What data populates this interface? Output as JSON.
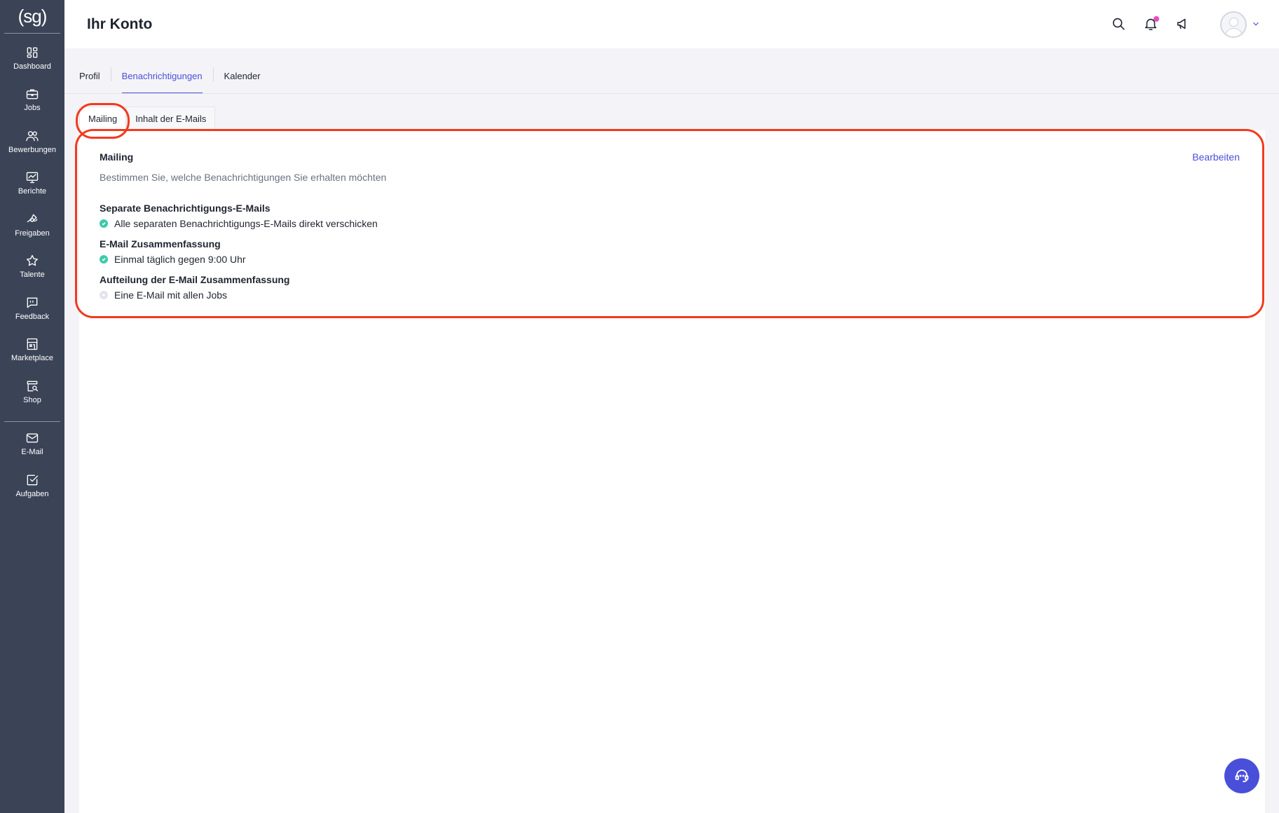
{
  "app": {
    "logo_text": "(sg)"
  },
  "sidebar": {
    "items": [
      {
        "label": "Dashboard",
        "icon": "dashboard-icon"
      },
      {
        "label": "Jobs",
        "icon": "briefcase-icon"
      },
      {
        "label": "Bewerbungen",
        "icon": "users-icon"
      },
      {
        "label": "Berichte",
        "icon": "chart-icon"
      },
      {
        "label": "Freigaben",
        "icon": "hand-sign-icon"
      },
      {
        "label": "Talente",
        "icon": "star-icon"
      },
      {
        "label": "Feedback",
        "icon": "chat-quote-icon"
      },
      {
        "label": "Marketplace",
        "icon": "store-icon"
      },
      {
        "label": "Shop",
        "icon": "shop-search-icon"
      },
      {
        "label": "E-Mail",
        "icon": "mail-icon"
      },
      {
        "label": "Aufgaben",
        "icon": "checkbox-icon"
      }
    ]
  },
  "header": {
    "title": "Ihr Konto"
  },
  "tabs": [
    {
      "label": "Profil",
      "active": false
    },
    {
      "label": "Benachrichtigungen",
      "active": true
    },
    {
      "label": "Kalender",
      "active": false
    }
  ],
  "subtabs": [
    {
      "label": "Mailing",
      "active": true
    },
    {
      "label": "Inhalt der E-Mails",
      "active": false
    }
  ],
  "card": {
    "title": "Mailing",
    "edit_label": "Bearbeiten",
    "description": "Bestimmen Sie, welche Benachrichtigungen Sie erhalten möchten",
    "sections": [
      {
        "title": "Separate Benachrichtigungs-E-Mails",
        "item": "Alle separaten Benachrichtigungs-E-Mails direkt verschicken",
        "enabled": true
      },
      {
        "title": "E-Mail Zusammenfassung",
        "item": "Einmal täglich gegen 9:00 Uhr",
        "enabled": true
      },
      {
        "title": "Aufteilung der E-Mail Zusammenfassung",
        "item": "Eine E-Mail mit allen Jobs",
        "enabled": false
      }
    ]
  },
  "colors": {
    "accent": "#4a4fd9",
    "sidebar": "#3b4457",
    "success": "#3fcba9",
    "annotation": "#f23a1e",
    "badge": "#e84cc4"
  }
}
